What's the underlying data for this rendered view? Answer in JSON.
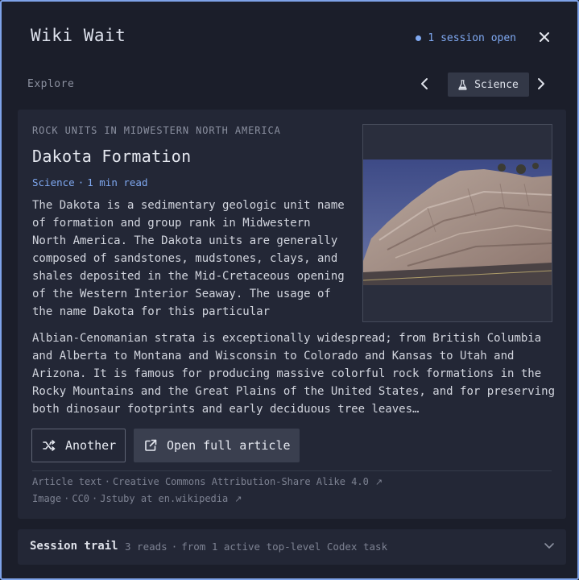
{
  "app": {
    "title": "Wiki Wait",
    "session_status": "1 session open",
    "status_color": "#7fa8f0"
  },
  "header": {
    "close_icon": "close-icon"
  },
  "explore": {
    "label": "Explore",
    "category": "Science",
    "category_icon": "flask-icon"
  },
  "article": {
    "kicker": "ROCK UNITS IN MIDWESTERN NORTH AMERICA",
    "title": "Dakota Formation",
    "category": "Science",
    "read_time": "1 min read",
    "body_part1": "The Dakota is a sedimentary geologic unit name of formation and group rank in Midwestern North America. The Dakota units are generally composed of sandstones, mudstones, clays, and shales deposited in the Mid-Cretaceous opening of the Western Interior Seaway. The usage of the name Dakota for this particular",
    "body_part2": "Albian-Cenomanian strata is exceptionally widespread; from British Columbia and Alberta to Montana and Wisconsin to Colorado and Kansas to Utah and Arizona. It is famous for producing massive colorful rock formations in the Rocky Mountains and the Great Plains of the United States, and for preserving both dinosaur footprints and early deciduous tree leaves…"
  },
  "actions": {
    "another_label": "Another",
    "open_label": "Open full article"
  },
  "credits": {
    "text_label": "Article text",
    "text_license": "Creative Commons Attribution-Share Alike 4.0",
    "image_label": "Image",
    "image_license": "CC0",
    "image_author": "Jstuby at en.wikipedia"
  },
  "trail": {
    "title": "Session trail",
    "reads": "3 reads",
    "source": "from 1 active top-level Codex task"
  }
}
